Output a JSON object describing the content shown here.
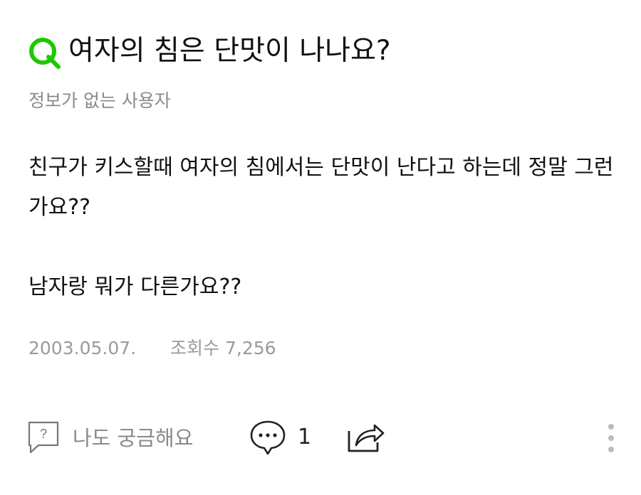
{
  "question": {
    "title": "여자의 침은 단맛이 나나요?",
    "author": "정보가 없는 사용자",
    "body": [
      "친구가 키스할때 여자의 침에서는 단맛이 난다고 하는데 정말 그런가요??",
      "남자랑 뭐가 다른가요??"
    ],
    "date": "2003.05.07.",
    "views": "조회수 7,256"
  },
  "actions": {
    "curious_label": "나도 궁금해요",
    "comment_count": "1"
  },
  "colors": {
    "brand_green": "#1ec800",
    "muted_text": "#8a8a8a",
    "icon_gray": "#555555"
  }
}
